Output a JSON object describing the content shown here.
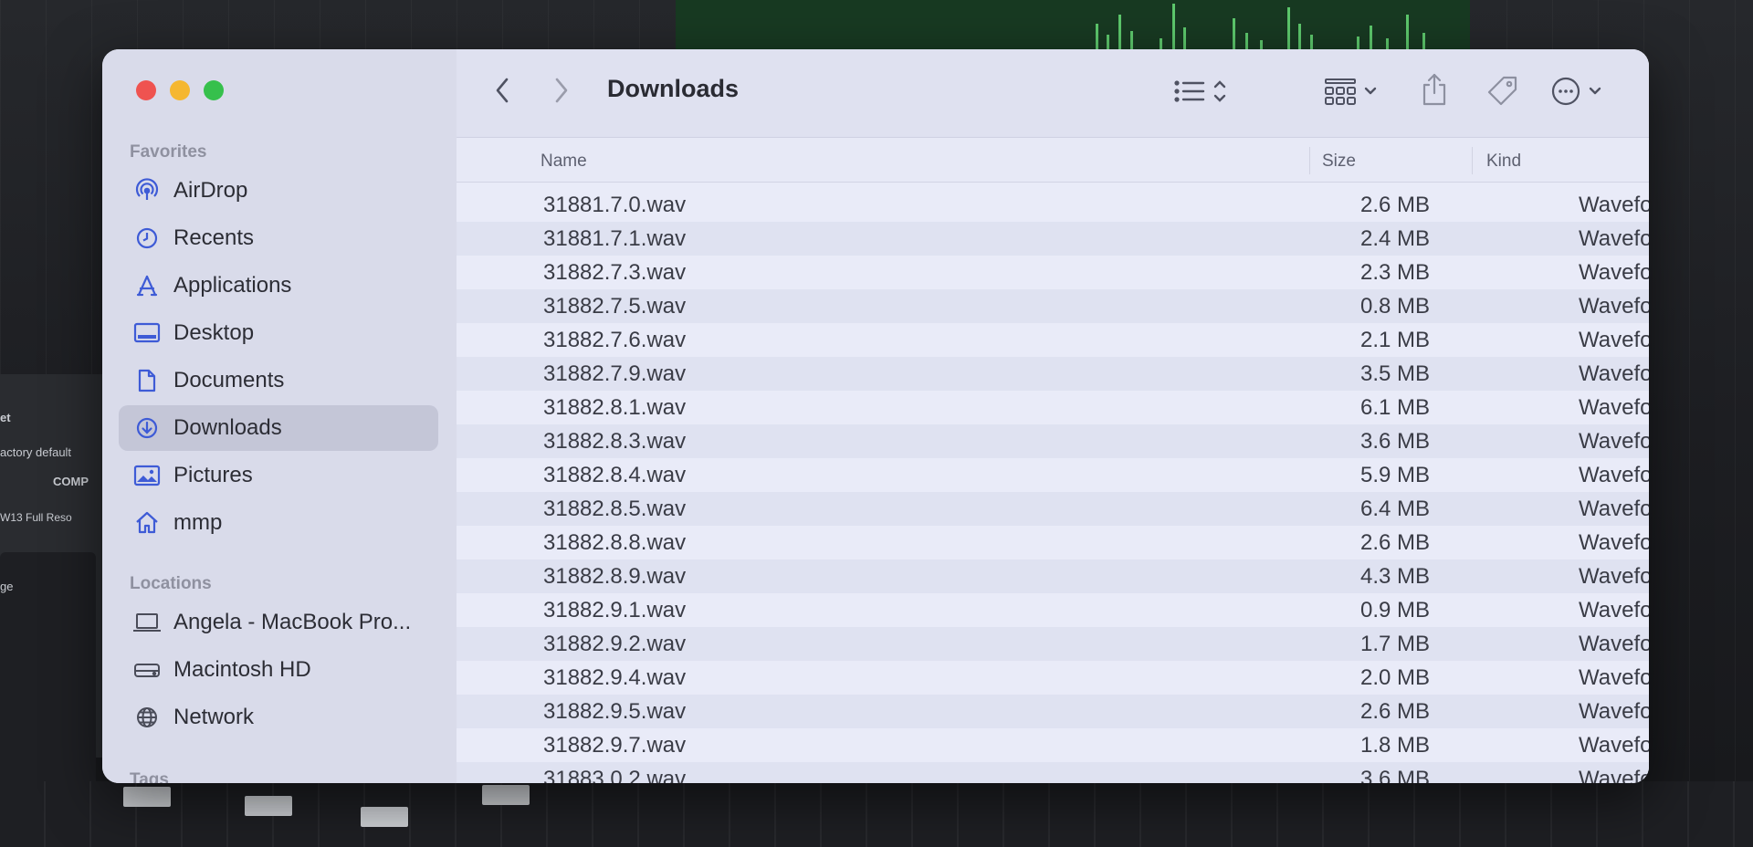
{
  "window": {
    "title": "Downloads"
  },
  "sidebar": {
    "favorites_title": "Favorites",
    "favorites": [
      {
        "label": "AirDrop",
        "icon": "airdrop-icon"
      },
      {
        "label": "Recents",
        "icon": "clock-icon"
      },
      {
        "label": "Applications",
        "icon": "applications-icon"
      },
      {
        "label": "Desktop",
        "icon": "desktop-icon"
      },
      {
        "label": "Documents",
        "icon": "document-icon"
      },
      {
        "label": "Downloads",
        "icon": "download-icon",
        "selected": true
      },
      {
        "label": "Pictures",
        "icon": "photo-icon"
      },
      {
        "label": "mmp",
        "icon": "home-icon"
      }
    ],
    "locations_title": "Locations",
    "locations": [
      {
        "label": "Angela - MacBook Pro...",
        "icon": "laptop-icon"
      },
      {
        "label": "Macintosh HD",
        "icon": "drive-icon"
      },
      {
        "label": "Network",
        "icon": "globe-icon"
      }
    ],
    "tags_title": "Tags"
  },
  "columns": {
    "name": "Name",
    "size": "Size",
    "kind": "Kind"
  },
  "files": [
    {
      "name": "31881.7.0.wav",
      "size": "2.6 MB",
      "kind": "Waveform audio"
    },
    {
      "name": "31881.7.1.wav",
      "size": "2.4 MB",
      "kind": "Waveform audio"
    },
    {
      "name": "31882.7.3.wav",
      "size": "2.3 MB",
      "kind": "Waveform audio"
    },
    {
      "name": "31882.7.5.wav",
      "size": "0.8 MB",
      "kind": "Waveform audio"
    },
    {
      "name": "31882.7.6.wav",
      "size": "2.1 MB",
      "kind": "Waveform audio"
    },
    {
      "name": "31882.7.9.wav",
      "size": "3.5 MB",
      "kind": "Waveform audio"
    },
    {
      "name": "31882.8.1.wav",
      "size": "6.1 MB",
      "kind": "Waveform audio"
    },
    {
      "name": "31882.8.3.wav",
      "size": "3.6 MB",
      "kind": "Waveform audio"
    },
    {
      "name": "31882.8.4.wav",
      "size": "5.9 MB",
      "kind": "Waveform audio"
    },
    {
      "name": "31882.8.5.wav",
      "size": "6.4 MB",
      "kind": "Waveform audio"
    },
    {
      "name": "31882.8.8.wav",
      "size": "2.6 MB",
      "kind": "Waveform audio"
    },
    {
      "name": "31882.8.9.wav",
      "size": "4.3 MB",
      "kind": "Waveform audio"
    },
    {
      "name": "31882.9.1.wav",
      "size": "0.9 MB",
      "kind": "Waveform audio"
    },
    {
      "name": "31882.9.2.wav",
      "size": "1.7 MB",
      "kind": "Waveform audio"
    },
    {
      "name": "31882.9.4.wav",
      "size": "2.0 MB",
      "kind": "Waveform audio"
    },
    {
      "name": "31882.9.5.wav",
      "size": "2.6 MB",
      "kind": "Waveform audio"
    },
    {
      "name": "31882.9.7.wav",
      "size": "1.8 MB",
      "kind": "Waveform audio"
    },
    {
      "name": "31883.0.2.wav",
      "size": "3.6 MB",
      "kind": "Waveform audio"
    }
  ],
  "background_app": {
    "labels": [
      "et",
      "actory default",
      "COMP",
      "W13 Full Reso",
      "ge"
    ]
  },
  "colors": {
    "close": "#ef5350",
    "minimize": "#f5b730",
    "zoom": "#36c04c",
    "sidebar_accent": "#3e5bd6",
    "selection": "#c4c6d7"
  }
}
